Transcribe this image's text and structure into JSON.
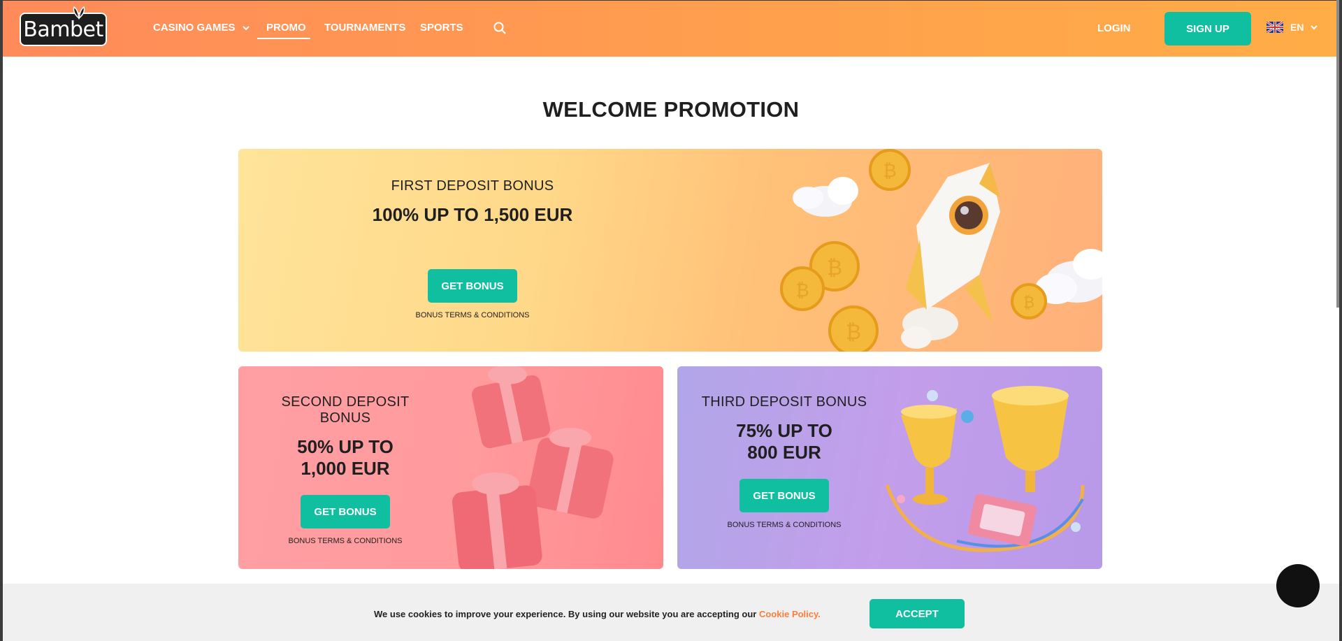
{
  "header": {
    "logo_text": "Bambet",
    "nav": [
      {
        "label": "CASINO GAMES"
      },
      {
        "label": "PROMO"
      },
      {
        "label": "TOURNAMENTS"
      },
      {
        "label": "SPORTS"
      }
    ],
    "login_label": "LOGIN",
    "signup_label": "SIGN UP",
    "language": "EN"
  },
  "main": {
    "title": "WELCOME PROMOTION",
    "cards": [
      {
        "label": "FIRST DEPOSIT BONUS",
        "amount_line1": "100% UP TO 1,500 EUR",
        "button": "GET BONUS",
        "terms": "BONUS TERMS & CONDITIONS"
      },
      {
        "label": "SECOND DEPOSIT BONUS",
        "amount_line1": "50% UP TO",
        "amount_line2": "1,000 EUR",
        "button": "GET BONUS",
        "terms": "BONUS TERMS & CONDITIONS"
      },
      {
        "label": "THIRD DEPOSIT BONUS",
        "amount_line1": "75% UP TO",
        "amount_line2": "800 EUR",
        "button": "GET BONUS",
        "terms": "BONUS TERMS & CONDITIONS"
      }
    ]
  },
  "cookie_bar": {
    "text": "We use cookies to improve your experience. By using our website you are accepting our ",
    "link": "Cookie Policy.",
    "accept_label": "ACCEPT"
  },
  "icons": [
    "logo-leaf-icon",
    "chevron-down-icon",
    "search-icon",
    "uk-flag-icon",
    "rocket-icon",
    "bitcoin-coin-icon",
    "cloud-icon",
    "gift-box-icon",
    "trophy-icon",
    "chat-icon"
  ],
  "colors": {
    "header_start": "#ff8a5a",
    "header_end": "#ffad47",
    "accent_teal": "#10bfa0",
    "cookie_link": "#ff7d3a"
  }
}
